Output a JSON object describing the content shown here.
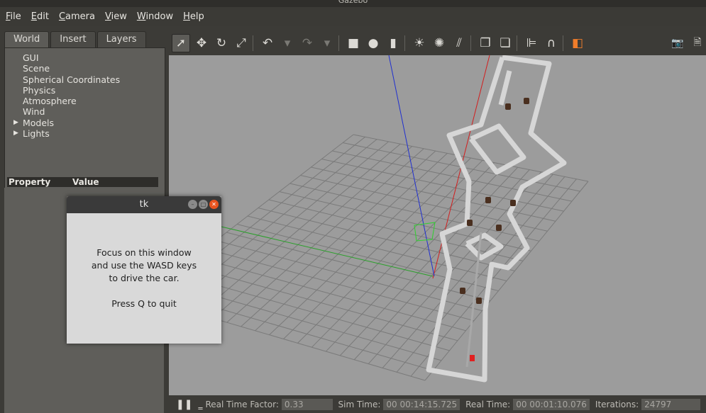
{
  "window": {
    "title": "Gazebo"
  },
  "menu": [
    {
      "key": "F",
      "rest": "ile"
    },
    {
      "key": "E",
      "rest": "dit"
    },
    {
      "key": "C",
      "rest": "amera"
    },
    {
      "key": "V",
      "rest": "iew"
    },
    {
      "key": "W",
      "rest": "indow"
    },
    {
      "key": "H",
      "rest": "elp"
    }
  ],
  "left_panel": {
    "tabs": [
      "World",
      "Insert",
      "Layers"
    ],
    "tree": [
      {
        "label": "GUI",
        "expandable": false
      },
      {
        "label": "Scene",
        "expandable": false
      },
      {
        "label": "Spherical Coordinates",
        "expandable": false
      },
      {
        "label": "Physics",
        "expandable": false
      },
      {
        "label": "Atmosphere",
        "expandable": false
      },
      {
        "label": "Wind",
        "expandable": false
      },
      {
        "label": "Models",
        "expandable": true
      },
      {
        "label": "Lights",
        "expandable": true
      }
    ],
    "property_header": {
      "property": "Property",
      "value": "Value"
    },
    "splitter": "....."
  },
  "toolbar_icons": [
    {
      "name": "select-mode-icon",
      "glyph": "➚",
      "selected": true
    },
    {
      "name": "translate-mode-icon",
      "glyph": "✥"
    },
    {
      "name": "rotate-mode-icon",
      "glyph": "↻"
    },
    {
      "name": "scale-mode-icon",
      "glyph": "⤢"
    },
    {
      "sep": true
    },
    {
      "name": "undo-icon",
      "glyph": "↶"
    },
    {
      "name": "undo-dropdown-icon",
      "glyph": "▾",
      "dim": true
    },
    {
      "name": "redo-icon",
      "glyph": "↷",
      "dim": true
    },
    {
      "name": "redo-dropdown-icon",
      "glyph": "▾",
      "dim": true
    },
    {
      "sep": true
    },
    {
      "name": "box-icon",
      "glyph": "■"
    },
    {
      "name": "sphere-icon",
      "glyph": "●"
    },
    {
      "name": "cylinder-icon",
      "glyph": "▮"
    },
    {
      "sep": true
    },
    {
      "name": "point-light-icon",
      "glyph": "☀"
    },
    {
      "name": "spot-light-icon",
      "glyph": "✺"
    },
    {
      "name": "directional-light-icon",
      "glyph": "⫽"
    },
    {
      "sep": true
    },
    {
      "name": "copy-icon",
      "glyph": "❐"
    },
    {
      "name": "paste-icon",
      "glyph": "❏"
    },
    {
      "sep": true
    },
    {
      "name": "align-icon",
      "glyph": "⊫"
    },
    {
      "name": "snap-icon",
      "glyph": "∩"
    },
    {
      "sep": true
    },
    {
      "name": "view-angle-icon",
      "glyph": "◧",
      "color": "#f07d2a"
    }
  ],
  "toolbar_right": [
    {
      "name": "screenshot-icon",
      "glyph": "📷"
    },
    {
      "name": "log-icon",
      "glyph": "🗎"
    }
  ],
  "tk_dialog": {
    "title": "tk",
    "lines": [
      "Focus on this window",
      "and use the WASD keys",
      "to drive the car.",
      "",
      "Press Q to quit"
    ]
  },
  "status": {
    "pause_glyph": "❚❚",
    "step_glyph": "‗",
    "rtf_label": "Real Time Factor:",
    "rtf_value": "0.33",
    "sim_label": "Sim Time:",
    "sim_value": "00 00:14:15.725",
    "real_label": "Real Time:",
    "real_value": "00 00:01:10.076",
    "iter_label": "Iterations:",
    "iter_value": "24797"
  },
  "colors": {
    "viewport_bg": "#9c9c9c",
    "grid": "#7a7a7a",
    "wall": "#d6d6d6",
    "axis_x": "#d21e1e",
    "axis_y": "#2aa02a",
    "axis_z": "#1f2fd0",
    "obstacle": "#4a2f1f",
    "car": "#e02020"
  }
}
